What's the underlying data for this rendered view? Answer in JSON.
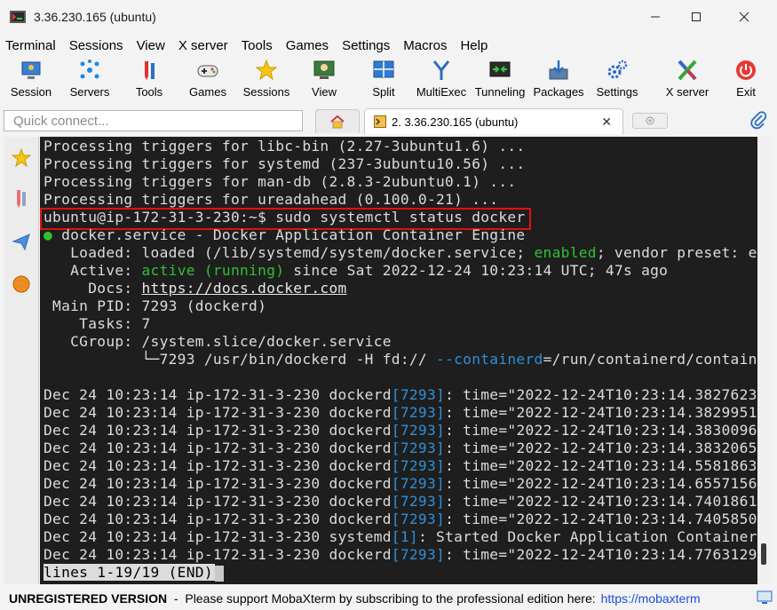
{
  "window": {
    "title": "3.36.230.165 (ubuntu)",
    "controls": [
      "minimize",
      "maximize",
      "close"
    ]
  },
  "menu": [
    "Terminal",
    "Sessions",
    "View",
    "X server",
    "Tools",
    "Games",
    "Settings",
    "Macros",
    "Help"
  ],
  "toolbar": [
    {
      "label": "Session",
      "icon": "session-icon"
    },
    {
      "label": "Servers",
      "icon": "servers-icon"
    },
    {
      "label": "Tools",
      "icon": "tools-icon"
    },
    {
      "label": "Games",
      "icon": "games-icon"
    },
    {
      "label": "Sessions",
      "icon": "star-icon"
    },
    {
      "label": "View",
      "icon": "view-icon"
    },
    {
      "label": "Split",
      "icon": "split-icon"
    },
    {
      "label": "MultiExec",
      "icon": "multiexec-icon"
    },
    {
      "label": "Tunneling",
      "icon": "tunneling-icon"
    },
    {
      "label": "Packages",
      "icon": "packages-icon"
    },
    {
      "label": "Settings",
      "icon": "gear-icon"
    },
    {
      "label": "X server",
      "icon": "xserver-icon"
    },
    {
      "label": "Exit",
      "icon": "power-icon"
    }
  ],
  "quick_connect": {
    "placeholder": "Quick connect..."
  },
  "tabs": {
    "active_label": "2. 3.36.230.165 (ubuntu)",
    "close": "✕"
  },
  "terminal": {
    "lines": [
      "Processing triggers for libc-bin (2.27-3ubuntu1.6) ...",
      "Processing triggers for systemd (237-3ubuntu10.56) ...",
      "Processing triggers for man-db (2.8.3-2ubuntu0.1) ...",
      "Processing triggers for ureadahead (0.100.0-21) ..."
    ],
    "prompt": "ubuntu@ip-172-31-3-230:~$ ",
    "command": "sudo systemctl status docker",
    "service_bullet": "●",
    "service_header": " docker.service - Docker Application Container Engine",
    "loaded_pre": "   Loaded: loaded (/lib/systemd/system/docker.service; ",
    "loaded_enabled": "enabled",
    "loaded_post": "; vendor preset: e",
    "active_pre": "   Active: ",
    "active_state": "active (running)",
    "active_post": " since Sat 2022-12-24 10:23:14 UTC; 47s ago",
    "docs_pre": "     Docs: ",
    "docs_link": "https://docs.docker.com",
    "mainpid": " Main PID: 7293 (dockerd)",
    "tasks": "    Tasks: 7",
    "cgroup": "   CGroup: /system.slice/docker.service",
    "cgroup_child_pre": "           └─7293 /usr/bin/dockerd -H fd:// ",
    "cgroup_child_opt": "--containerd",
    "cgroup_child_post": "=/run/containerd/contain",
    "log_lines": [
      {
        "prefix": "Dec 24 10:23:14 ip-172-31-3-230 dockerd",
        "pid": "[7293]",
        "msg": ": time=\"2022-12-24T10:23:14.3827623"
      },
      {
        "prefix": "Dec 24 10:23:14 ip-172-31-3-230 dockerd",
        "pid": "[7293]",
        "msg": ": time=\"2022-12-24T10:23:14.3829951"
      },
      {
        "prefix": "Dec 24 10:23:14 ip-172-31-3-230 dockerd",
        "pid": "[7293]",
        "msg": ": time=\"2022-12-24T10:23:14.3830096"
      },
      {
        "prefix": "Dec 24 10:23:14 ip-172-31-3-230 dockerd",
        "pid": "[7293]",
        "msg": ": time=\"2022-12-24T10:23:14.3832065"
      },
      {
        "prefix": "Dec 24 10:23:14 ip-172-31-3-230 dockerd",
        "pid": "[7293]",
        "msg": ": time=\"2022-12-24T10:23:14.5581863"
      },
      {
        "prefix": "Dec 24 10:23:14 ip-172-31-3-230 dockerd",
        "pid": "[7293]",
        "msg": ": time=\"2022-12-24T10:23:14.6557156"
      },
      {
        "prefix": "Dec 24 10:23:14 ip-172-31-3-230 dockerd",
        "pid": "[7293]",
        "msg": ": time=\"2022-12-24T10:23:14.7401861"
      },
      {
        "prefix": "Dec 24 10:23:14 ip-172-31-3-230 dockerd",
        "pid": "[7293]",
        "msg": ": time=\"2022-12-24T10:23:14.7405850"
      },
      {
        "prefix": "Dec 24 10:23:14 ip-172-31-3-230 systemd",
        "pid": "[1]",
        "msg": ": Started Docker Application Container"
      },
      {
        "prefix": "Dec 24 10:23:14 ip-172-31-3-230 dockerd",
        "pid": "[7293]",
        "msg": ": time=\"2022-12-24T10:23:14.7763129"
      }
    ],
    "pager_status": "lines 1-19/19 (END)"
  },
  "statusbar": {
    "unregistered": "UNREGISTERED VERSION",
    "message": "  -  Please support MobaXterm by subscribing to the professional edition here:",
    "link": "https://mobaxterm"
  },
  "colors": {
    "terminal_bg": "#1e1e1e",
    "terminal_fg": "#dcdcdc",
    "green": "#2ec22e",
    "pid_blue": "#2f8fd8",
    "highlight_box": "#e01010",
    "link": "#1a4ed8"
  }
}
